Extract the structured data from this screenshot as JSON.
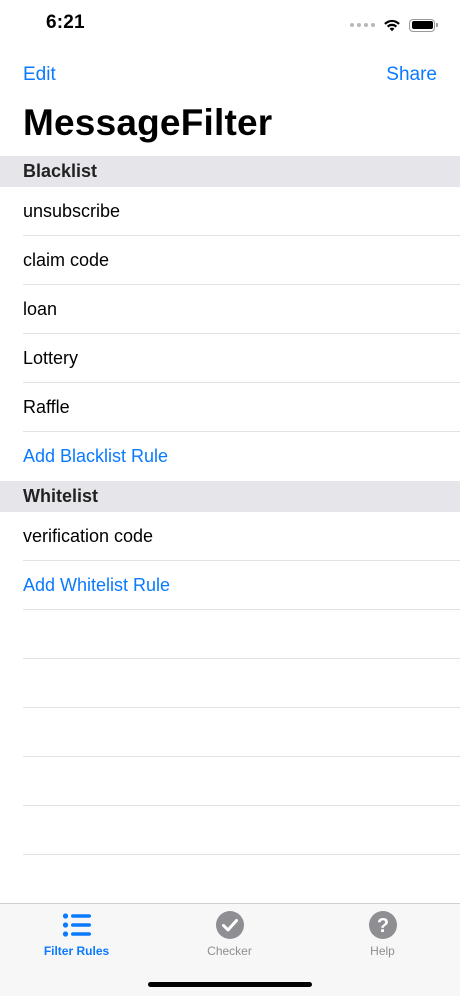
{
  "status_bar": {
    "time": "6:21"
  },
  "nav": {
    "edit_label": "Edit",
    "share_label": "Share",
    "title": "MessageFilter"
  },
  "sections": {
    "blacklist": {
      "header": "Blacklist",
      "rules": [
        "unsubscribe",
        "claim code",
        "loan",
        "Lottery",
        "Raffle"
      ],
      "add_label": "Add Blacklist Rule"
    },
    "whitelist": {
      "header": "Whitelist",
      "rules": [
        "verification code"
      ],
      "add_label": "Add Whitelist Rule"
    }
  },
  "tab_bar": {
    "tabs": [
      {
        "label": "Filter Rules",
        "icon": "list-icon",
        "active": true
      },
      {
        "label": "Checker",
        "icon": "checkmark-circle-icon",
        "active": false
      },
      {
        "label": "Help",
        "icon": "question-circle-icon",
        "active": false
      }
    ]
  },
  "colors": {
    "accent": "#0a7aff",
    "section_header_bg": "#e5e5ea",
    "inactive_tab": "#8e8e93"
  }
}
